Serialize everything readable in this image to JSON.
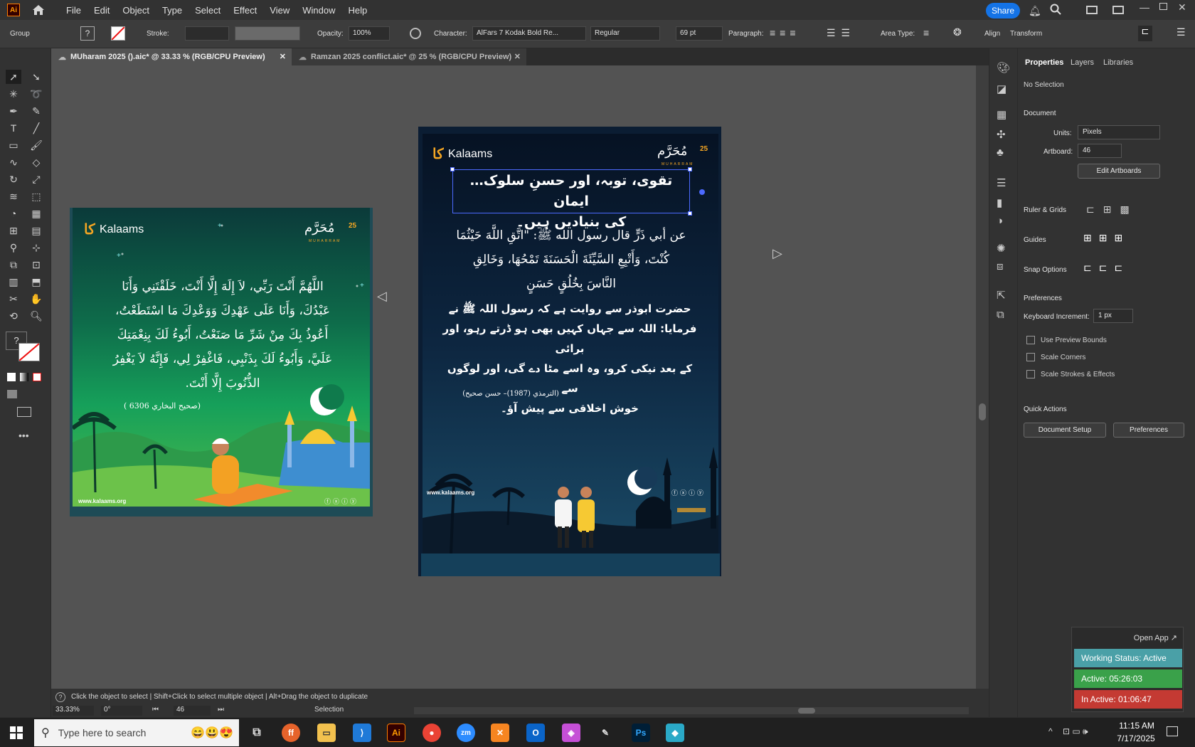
{
  "app": {
    "menu": [
      "File",
      "Edit",
      "Object",
      "Type",
      "Select",
      "Effect",
      "View",
      "Window",
      "Help"
    ],
    "share_label": "Share"
  },
  "control_bar": {
    "selection_label": "Group",
    "stroke_label": "Stroke:",
    "opacity_label": "Opacity:",
    "opacity_value": "100%",
    "character_label": "Character:",
    "font_name": "AlFars 7 Kodak Bold Re...",
    "font_style": "Regular",
    "font_size": "69 pt",
    "paragraph_label": "Paragraph:",
    "area_type_label": "Area Type:",
    "align_label": "Align",
    "transform_label": "Transform"
  },
  "tabs": [
    {
      "label": "MUharam 2025 ().aic* @ 33.33 % (RGB/CPU Preview)",
      "active": true
    },
    {
      "label": "Ramzan 2025 conflict.aic* @ 25 % (RGB/CPU Preview)",
      "active": false
    }
  ],
  "left_artboard": {
    "brand": "Kalaams",
    "badge_title": "مُحَرَّم",
    "badge_number": "25",
    "badge_subtitle": "MUHARRAM",
    "dua_lines": [
      "اللَّهُمَّ أَنْتَ رَبِّي، لاَ إِلَهَ إِلَّا أَنْتَ، خَلَقْتَنِي وَأَنَا",
      "عَبْدُكَ، وَأَنَا عَلَى عَهْدِكَ وَوَعْدِكَ مَا اسْتَطَعْتُ،",
      "أَعُوذُ بِكَ مِنْ شَرِّ مَا صَنَعْتُ، أَبُوءُ لَكَ بِنِعْمَتِكَ",
      "عَلَيَّ، وَأَبُوءُ لَكَ بِذَنْبِي، فَاغْفِرْ لِي، فَإِنَّهُ لاَ يَغْفِرُ",
      "الذُّنُوبَ إِلَّا أَنْتَ."
    ],
    "reference": "(صحيح البخاري 6306 )",
    "website": "www.kalaams.org"
  },
  "right_artboard": {
    "brand": "Kalaams",
    "badge_title": "مُحَرَّم",
    "badge_number": "25",
    "badge_subtitle": "MUHARRAM",
    "headline_lines": [
      "تقوی، توبہ، اور حسنِ سلوک… ایمان",
      "کی بنیادیں ہیں۔"
    ],
    "hadith_lines": [
      "عن أبي ذَرٍّ قال رسول الله ﷺ: \"اتَّقِ اللَّهَ حَيْثُمَا",
      "كُنْتَ، وَأَتْبِعِ السَّيِّئَةَ الْحَسَنَةَ تَمْحُهَا، وَخَالِقِ",
      "النَّاسَ بِخُلُقٍ حَسَنٍ"
    ],
    "translation_lines": [
      "حضرت ابوذر سے روایت ہے کہ رسول اللہ ﷺ نے",
      "فرمایا: اللہ سے جہاں کہیں بھی ہو ڈرتے رہو، اور برائی",
      "کے بعد نیکی کرو، وہ اسے مٹا دے گی، اور لوگوں سے",
      "خوش اخلاقی سے پیش آؤ۔"
    ],
    "reference": "(الترمذي (1987)– حسن صحيح)",
    "website": "www.kalaams.org"
  },
  "properties_panel": {
    "tabs": [
      "Properties",
      "Layers",
      "Libraries"
    ],
    "selection_status": "No Selection",
    "document_heading": "Document",
    "units_label": "Units:",
    "units_value": "Pixels",
    "artboard_label": "Artboard:",
    "artboard_value": "46",
    "edit_artboards_label": "Edit Artboards",
    "ruler_grids_label": "Ruler & Grids",
    "guides_label": "Guides",
    "snap_options_label": "Snap Options",
    "preferences_heading": "Preferences",
    "keyboard_increment_label": "Keyboard Increment:",
    "keyboard_increment_value": "1 px",
    "checkboxes": [
      "Use Preview Bounds",
      "Scale Corners",
      "Scale Strokes & Effects"
    ],
    "quick_actions_heading": "Quick Actions",
    "document_setup_label": "Document Setup",
    "preferences_button_label": "Preferences"
  },
  "status_bar": {
    "hint": "Click the object to select  |  Shift+Click to select multiple object  |  Alt+Drag the object to duplicate",
    "zoom": "33.33%",
    "rotation": "0°",
    "artboard_number": "46",
    "tool_name": "Selection"
  },
  "status_widget": {
    "open_app": "Open App ↗",
    "working_status": "Working Status: Active",
    "active_time": "Active: 05:26:03",
    "inactive_time": "In Active: 01:06:47",
    "colors": {
      "working": "#4aa0a7",
      "active": "#3aa14a",
      "inactive": "#c43a33"
    }
  },
  "taskbar": {
    "search_placeholder": "Type here to search",
    "time": "11:15 AM",
    "date": "7/17/2025",
    "apps": [
      "task-view",
      "firefox",
      "file-explorer",
      "vscode",
      "illustrator",
      "chrome",
      "zoom",
      "xampp",
      "outlook",
      "affinity",
      "pen-tool",
      "photoshop",
      "app"
    ]
  }
}
